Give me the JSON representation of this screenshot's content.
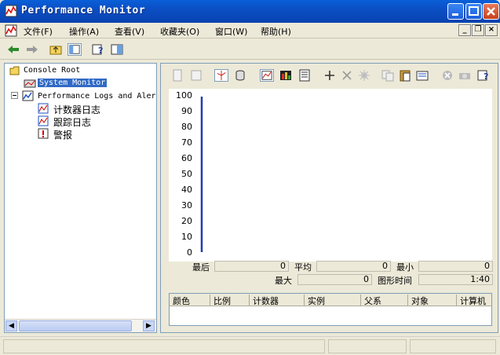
{
  "window": {
    "title": "Performance Monitor"
  },
  "menu": {
    "items": [
      "文件(F)",
      "操作(A)",
      "查看(V)",
      "收藏夹(O)",
      "窗口(W)",
      "帮助(H)"
    ]
  },
  "tree": {
    "root": "Console Root",
    "system_monitor": "System Monitor",
    "perf_logs": "Performance Logs and Aler",
    "counter_logs": "计数器日志",
    "trace_logs": "跟踪日志",
    "alerts": "警报"
  },
  "stats": {
    "last_label": "最后",
    "last_value": "0",
    "avg_label": "平均",
    "avg_value": "0",
    "min_label": "最小",
    "min_value": "0",
    "max_label": "最大",
    "max_value": "0",
    "duration_label": "图形时间",
    "duration_value": "1:40"
  },
  "legend": {
    "columns": [
      "颜色",
      "比例",
      "计数器",
      "实例",
      "父系",
      "对象",
      "计算机"
    ]
  },
  "chart_data": {
    "type": "line",
    "ylim": [
      0,
      100
    ],
    "yticks": [
      "100",
      "90",
      "80",
      "70",
      "60",
      "50",
      "40",
      "30",
      "20",
      "10",
      "0"
    ],
    "series": []
  },
  "colors": {
    "titlebar": "#0b4fc4",
    "selection": "#316ac5",
    "timebar": "#1f3cb4"
  }
}
